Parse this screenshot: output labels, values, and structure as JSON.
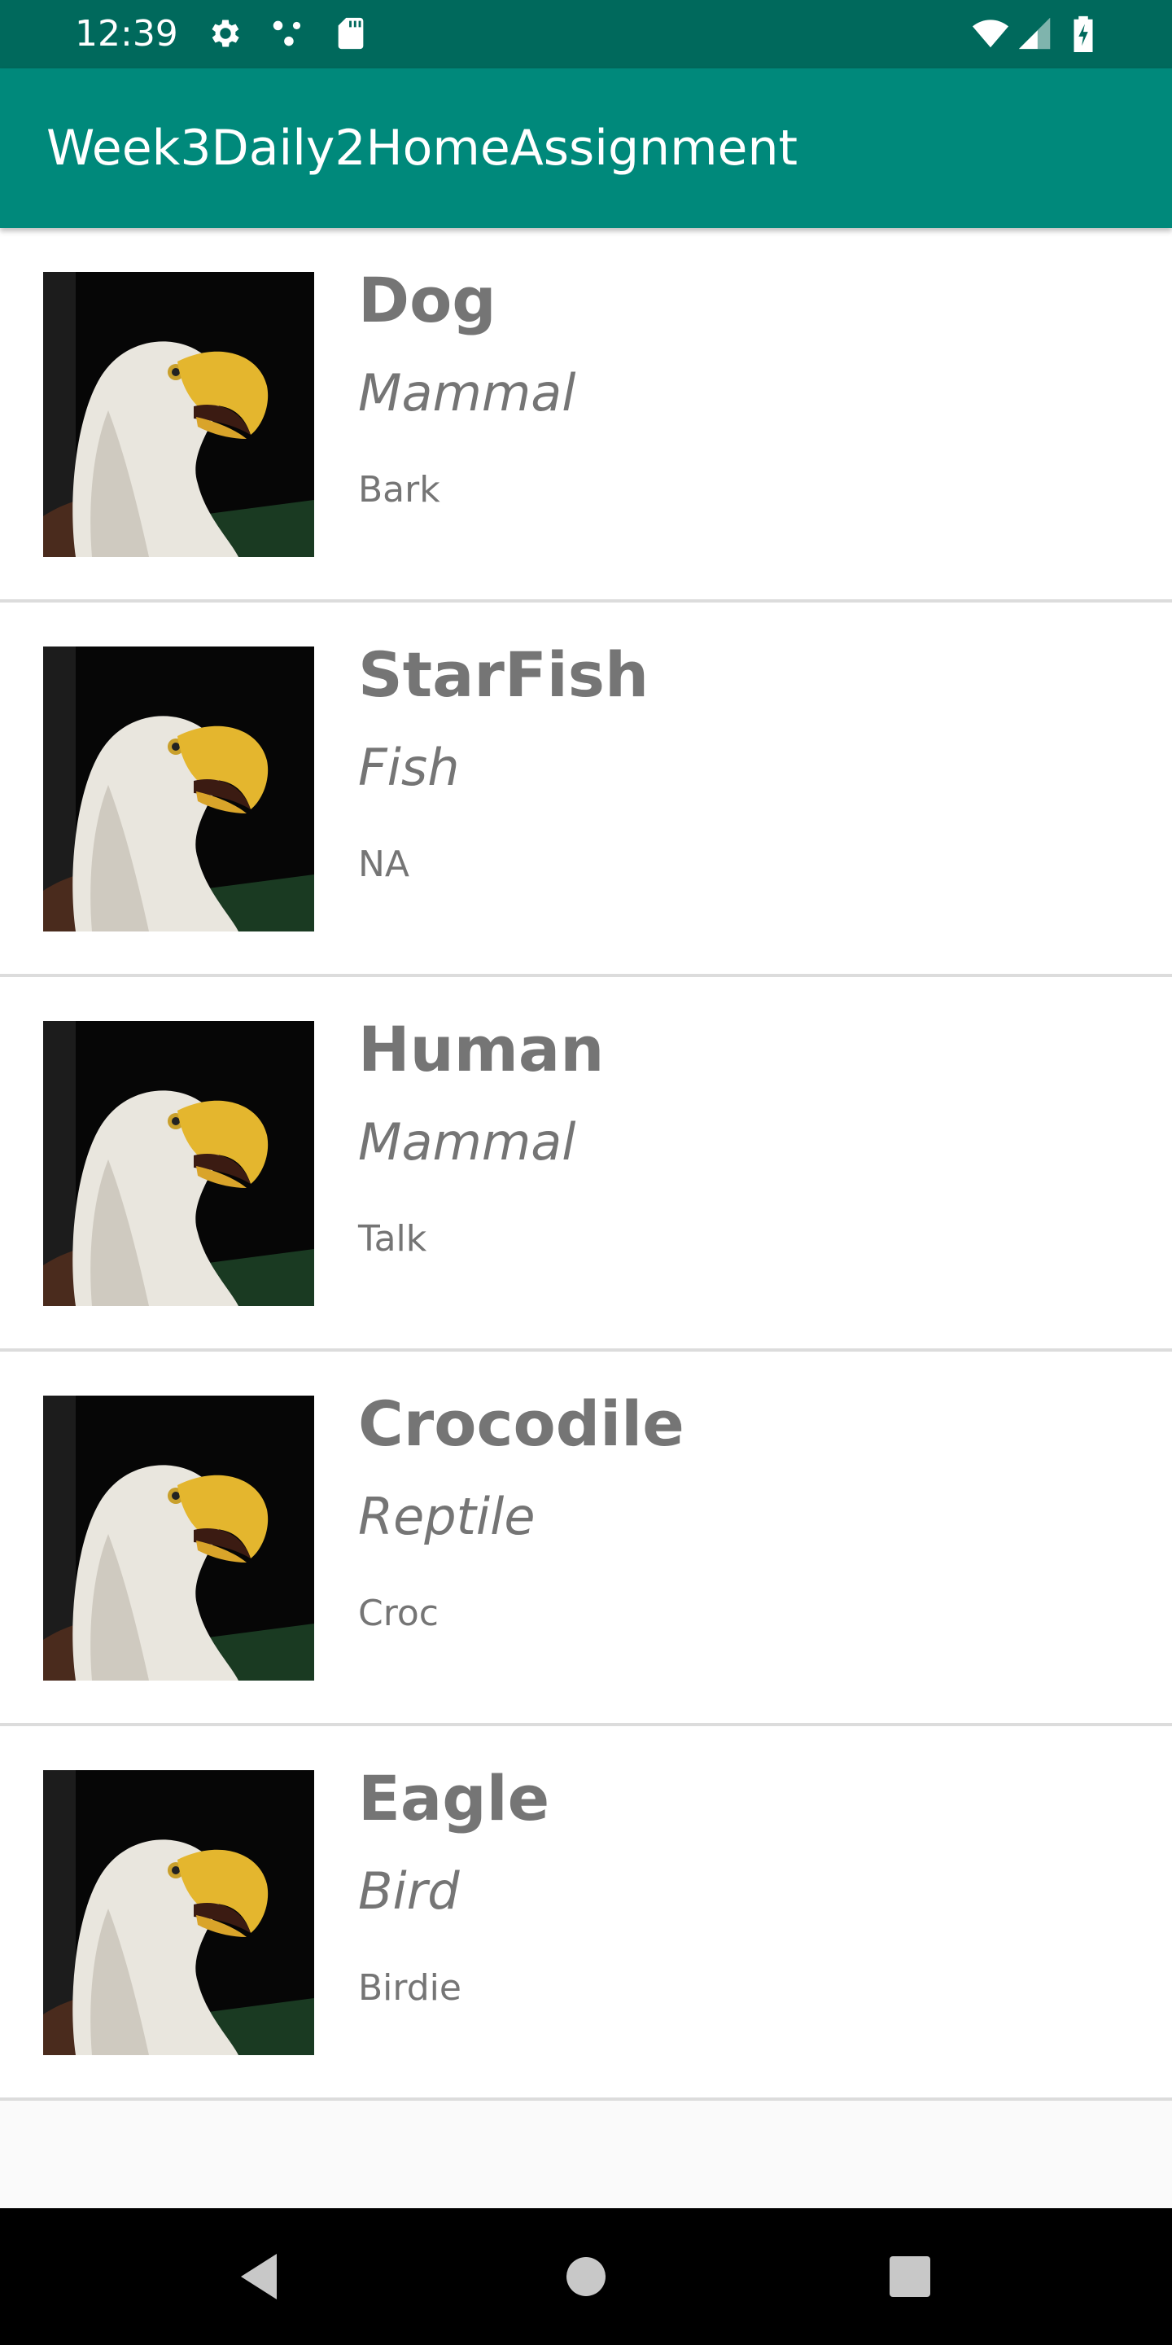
{
  "status_bar": {
    "time": "12:39",
    "icons": [
      "settings-icon",
      "notification-dots-icon",
      "sd-card-icon",
      "wifi-icon",
      "signal-icon",
      "battery-charging-icon"
    ]
  },
  "app_bar": {
    "title": "Week3Daily2HomeAssignment",
    "color": "#00897b"
  },
  "animals": [
    {
      "name": "Dog",
      "type": "Mammal",
      "sound": "Bark"
    },
    {
      "name": "StarFish",
      "type": "Fish",
      "sound": "NA"
    },
    {
      "name": "Human",
      "type": "Mammal",
      "sound": "Talk"
    },
    {
      "name": "Crocodile",
      "type": "Reptile",
      "sound": "Croc"
    },
    {
      "name": "Eagle",
      "type": "Bird",
      "sound": "Birdie"
    }
  ],
  "nav_bar": {
    "buttons": [
      "back-icon",
      "home-icon",
      "recents-icon"
    ]
  }
}
